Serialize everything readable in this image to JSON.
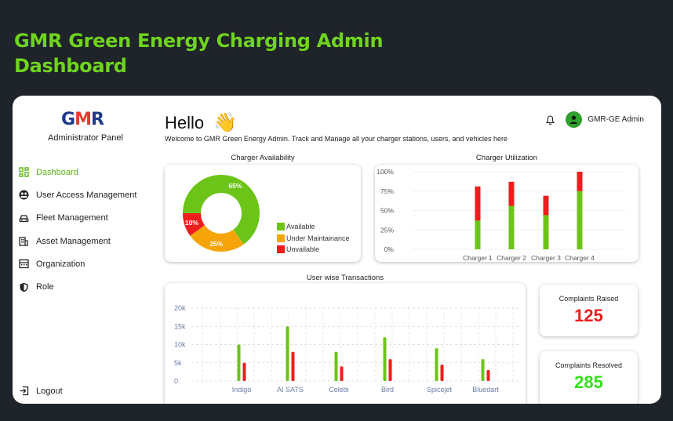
{
  "page": {
    "heading": "GMR Green Energy Charging Admin Dashboard"
  },
  "sidebar": {
    "logo": {
      "g": "G",
      "m": "M",
      "r": "R"
    },
    "panel_label": "Administrator Panel",
    "items": [
      {
        "label": "Dashboard",
        "icon": "dashboard-grid-icon",
        "active": true
      },
      {
        "label": "User Access Management",
        "icon": "user-access-icon",
        "active": false
      },
      {
        "label": "Fleet Management",
        "icon": "car-icon",
        "active": false
      },
      {
        "label": "Asset Management",
        "icon": "asset-icon",
        "active": false
      },
      {
        "label": "Organization",
        "icon": "building-icon",
        "active": false
      },
      {
        "label": "Role",
        "icon": "shield-icon",
        "active": false
      }
    ],
    "logout_label": "Logout"
  },
  "header": {
    "greeting": "Hello",
    "wave": "👋",
    "welcome": "Welcome to GMR Green Energy Admin. Track and Manage all your charger stations, users, and vehicles here",
    "user_name": "GMR-GE Admin"
  },
  "colors": {
    "brand_green": "#6fd41e",
    "green": "#6cc418",
    "orange": "#f5a50a",
    "red": "#ee1d1d",
    "kpi_red": "#ee1d1d",
    "kpi_green": "#33e21a"
  },
  "charts": {
    "availability": {
      "title": "Charger Availability"
    },
    "utilization": {
      "title": "Charger Utilization"
    },
    "transactions": {
      "title": "User wise Transactions"
    }
  },
  "chart_data": [
    {
      "type": "pie",
      "title": "Charger Availability",
      "labels": [
        "Available",
        "Under Maintainance",
        "Unvailable"
      ],
      "values": [
        65,
        25,
        10
      ],
      "value_labels": [
        "65%",
        "25%",
        "10%"
      ],
      "colors": [
        "#6cc418",
        "#f5a50a",
        "#ee1d1d"
      ],
      "legend": "right"
    },
    {
      "type": "bar",
      "title": "Charger Utilization",
      "categories": [
        "Charger 1",
        "Charger 2",
        "Charger 3",
        "Charger 4"
      ],
      "series": [
        {
          "values": [
            37,
            56,
            44,
            75
          ],
          "color": "#6cc418"
        },
        {
          "values": [
            44,
            31,
            25,
            25
          ],
          "color": "#ee1d1d"
        }
      ],
      "stacked": true,
      "yticks": [
        "0%",
        "25%",
        "50%",
        "75%",
        "100%"
      ],
      "ylim": [
        0,
        100
      ]
    },
    {
      "type": "bar",
      "title": "User wise Transactions",
      "categories": [
        "Indigo",
        "AI SATS",
        "Celebi",
        "Bird",
        "Spicejet",
        "Bluedart"
      ],
      "series": [
        {
          "values": [
            10000,
            15000,
            8000,
            12000,
            9000,
            6000
          ],
          "color": "#6cc418"
        },
        {
          "values": [
            5000,
            8000,
            4000,
            6000,
            4500,
            3000
          ],
          "color": "#ee1d1d"
        }
      ],
      "yticks": [
        "0",
        "5k",
        "10k",
        "15k",
        "20k"
      ],
      "ylim": [
        0,
        20000
      ]
    }
  ],
  "kpis": [
    {
      "label": "Complaints Raised",
      "value": "125"
    },
    {
      "label": "Complaints Resolved",
      "value": "285"
    }
  ]
}
